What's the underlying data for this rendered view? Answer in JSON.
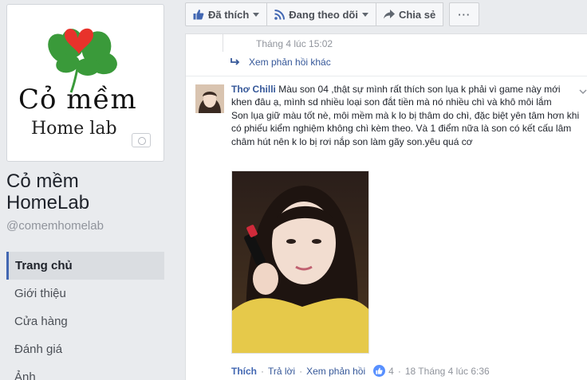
{
  "page": {
    "name": "Cỏ mềm HomeLab",
    "handle": "@comemhomelab",
    "logo": {
      "line1": "Cỏ mềm",
      "line2": "Home lab"
    },
    "nav": [
      {
        "label": "Trang chủ",
        "active": true
      },
      {
        "label": "Giới thiệu",
        "active": false
      },
      {
        "label": "Cửa hàng",
        "active": false
      },
      {
        "label": "Đánh giá",
        "active": false
      },
      {
        "label": "Ảnh",
        "active": false
      }
    ]
  },
  "actions": {
    "liked": "Đã thích",
    "following": "Đang theo dõi",
    "share": "Chia sẻ",
    "more": "···"
  },
  "feed": {
    "previous_time": "Tháng 4 lúc 15:02",
    "more_replies": "Xem phản hồi khác",
    "comment": {
      "author": "Thơ Chilli",
      "text_1": " Màu son 04 ,thật sự mình rất thích son lụa k phải vì game này mới khen đâu ạ, mình sd nhiều loại son đắt tiền mà nó nhiều chì và khô môi lắm",
      "text_2": "Son lụa giữ màu tốt nè, môi mềm mà k lo bị thâm do chì, đặc biệt yên tâm hơn khi có phiếu kiểm nghiệm không chì kèm theo. Và 1 điểm nữa là son có kết cấu lâm châm hút nên k lo bị rơi nắp son làm gãy son.yêu quá cơ",
      "like_label": "Thích",
      "reply_label": "Trả lời",
      "view_replies_label": "Xem phản hồi",
      "like_count": "4",
      "time": "18 Tháng 4 lúc 6:36"
    }
  },
  "colors": {
    "link": "#365899",
    "nav_accent": "#4267b2",
    "clover": "#3a9a3a",
    "heart": "#e8322b"
  }
}
